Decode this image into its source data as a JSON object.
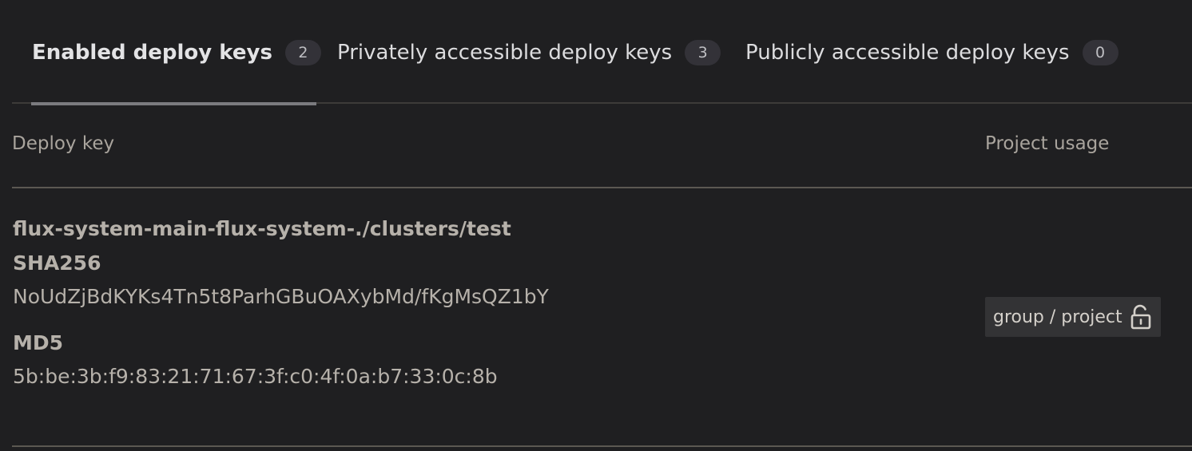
{
  "tabs": [
    {
      "label": "Enabled deploy keys",
      "count": "2",
      "active": true
    },
    {
      "label": "Privately accessible deploy keys",
      "count": "3",
      "active": false
    },
    {
      "label": "Publicly accessible deploy keys",
      "count": "0",
      "active": false
    }
  ],
  "table": {
    "headers": {
      "deploy_key": "Deploy key",
      "project_usage": "Project usage"
    },
    "rows": [
      {
        "title": "flux-system-main-flux-system-./clusters/test",
        "sha_label": "SHA256",
        "sha_value": "NoUdZjBdKYKs4Tn5t8ParhGBuOAXybMd/fKgMsQZ1bY",
        "md5_label": "MD5",
        "md5_value": "5b:be:3b:f9:83:21:71:67:3f:c0:4f:0a:b7:33:0c:8b",
        "project_usage": "group / project",
        "usage_icon": "lock-open-icon"
      }
    ]
  },
  "colors": {
    "background": "#1f1f21",
    "text_muted": "#a9a49d",
    "badge_bg": "#333238"
  }
}
